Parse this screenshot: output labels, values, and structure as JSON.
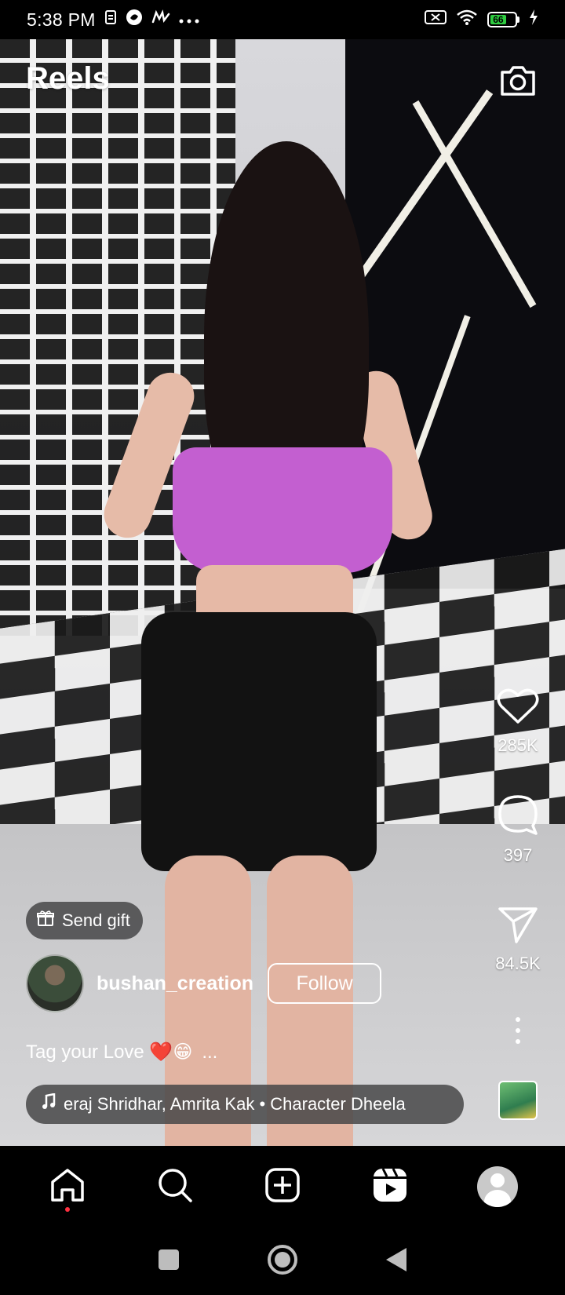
{
  "status_bar": {
    "time": "5:38 PM",
    "battery_level": "66",
    "battery_color": "#2ecc40",
    "icons_left": [
      "sim-icon",
      "app-icon",
      "app-icon",
      "more-dots-icon"
    ],
    "icons_right": [
      "no-sim-icon",
      "wifi-icon",
      "battery-icon",
      "charging-icon"
    ]
  },
  "header": {
    "title": "Reels",
    "camera_icon": "camera-icon"
  },
  "actions": {
    "like": {
      "icon": "heart-icon",
      "count": "285K"
    },
    "comment": {
      "icon": "comment-icon",
      "count": "397"
    },
    "share": {
      "icon": "send-icon",
      "count": "84.5K"
    },
    "more_icon": "more-vertical-icon"
  },
  "post": {
    "send_gift_label": "Send gift",
    "username": "bushan_creation",
    "follow_label": "Follow",
    "caption": "Tag your Love ❤️😁",
    "caption_more": "...",
    "audio_text": "eraj Shridhar, Amrita Kak • Character Dheela"
  },
  "bottom_nav": {
    "items": [
      "home-icon",
      "search-icon",
      "create-icon",
      "reels-icon",
      "profile-avatar"
    ],
    "active": "home",
    "notification_color": "#ff3040"
  },
  "system_nav": [
    "recents-button",
    "home-button",
    "back-button"
  ]
}
